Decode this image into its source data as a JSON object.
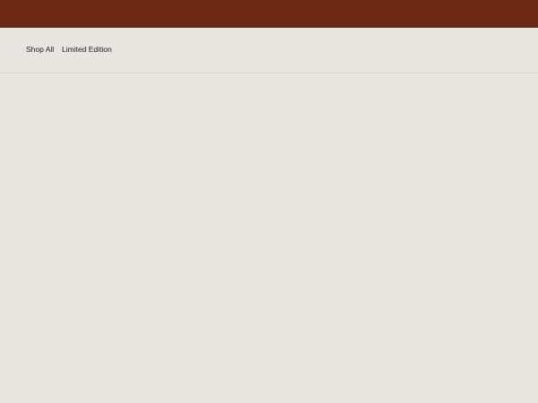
{
  "header": {
    "bar_color": "#6b2915"
  },
  "nav": {
    "items": [
      {
        "label": "Shop All"
      },
      {
        "label": "Limited Edition"
      }
    ]
  },
  "colors": {
    "background": "#e9e6e1",
    "divider": "#d3cfc9",
    "text": "#1c1c1c"
  }
}
